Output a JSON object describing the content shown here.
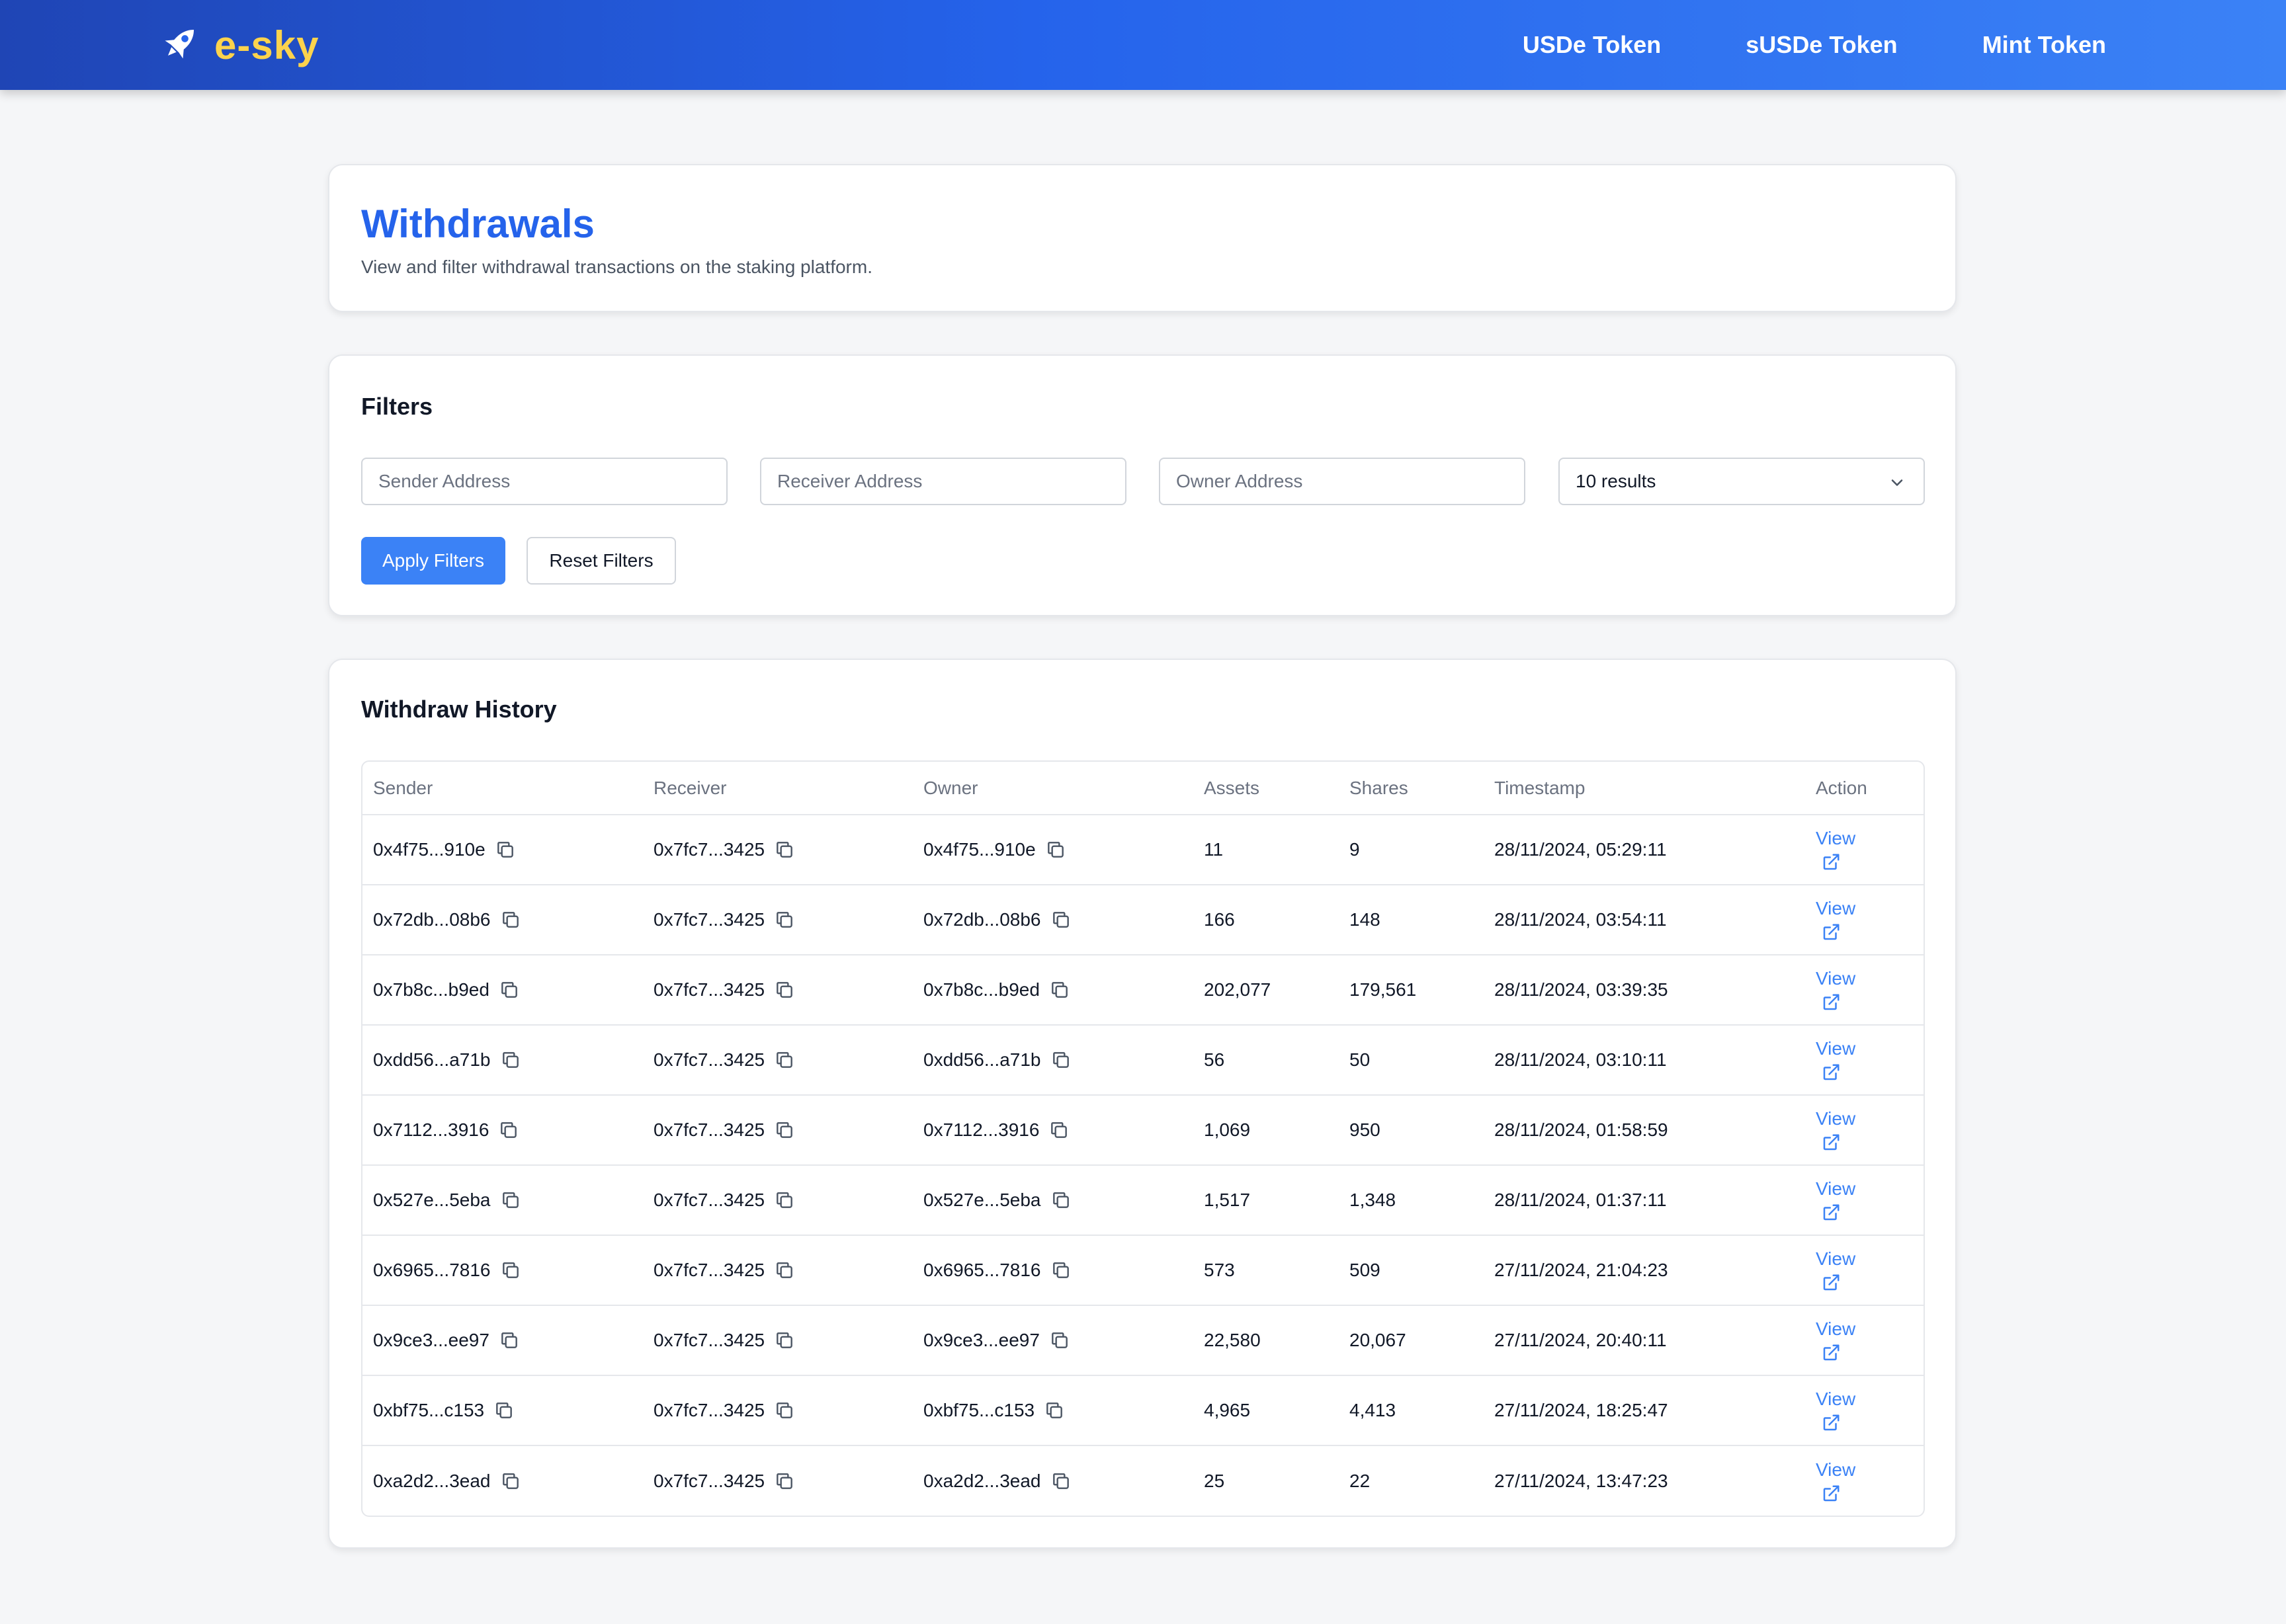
{
  "brand": {
    "name": "e-sky",
    "icon": "rocket-icon",
    "color": "#fcd34d"
  },
  "nav": {
    "links": [
      "USDe Token",
      "sUSDe Token",
      "Mint Token"
    ]
  },
  "header": {
    "title": "Withdrawals",
    "subtitle": "View and filter withdrawal transactions on the staking platform."
  },
  "filters": {
    "title": "Filters",
    "sender_placeholder": "Sender Address",
    "receiver_placeholder": "Receiver Address",
    "owner_placeholder": "Owner Address",
    "results_selected": "10 results",
    "apply_label": "Apply Filters",
    "reset_label": "Reset Filters"
  },
  "history": {
    "title": "Withdraw History",
    "columns": [
      "Sender",
      "Receiver",
      "Owner",
      "Assets",
      "Shares",
      "Timestamp",
      "Action"
    ],
    "view_label": "View",
    "rows": [
      {
        "sender": "0x4f75...910e",
        "receiver": "0x7fc7...3425",
        "owner": "0x4f75...910e",
        "assets": "11",
        "shares": "9",
        "timestamp": "28/11/2024, 05:29:11"
      },
      {
        "sender": "0x72db...08b6",
        "receiver": "0x7fc7...3425",
        "owner": "0x72db...08b6",
        "assets": "166",
        "shares": "148",
        "timestamp": "28/11/2024, 03:54:11"
      },
      {
        "sender": "0x7b8c...b9ed",
        "receiver": "0x7fc7...3425",
        "owner": "0x7b8c...b9ed",
        "assets": "202,077",
        "shares": "179,561",
        "timestamp": "28/11/2024, 03:39:35"
      },
      {
        "sender": "0xdd56...a71b",
        "receiver": "0x7fc7...3425",
        "owner": "0xdd56...a71b",
        "assets": "56",
        "shares": "50",
        "timestamp": "28/11/2024, 03:10:11"
      },
      {
        "sender": "0x7112...3916",
        "receiver": "0x7fc7...3425",
        "owner": "0x7112...3916",
        "assets": "1,069",
        "shares": "950",
        "timestamp": "28/11/2024, 01:58:59"
      },
      {
        "sender": "0x527e...5eba",
        "receiver": "0x7fc7...3425",
        "owner": "0x527e...5eba",
        "assets": "1,517",
        "shares": "1,348",
        "timestamp": "28/11/2024, 01:37:11"
      },
      {
        "sender": "0x6965...7816",
        "receiver": "0x7fc7...3425",
        "owner": "0x6965...7816",
        "assets": "573",
        "shares": "509",
        "timestamp": "27/11/2024, 21:04:23"
      },
      {
        "sender": "0x9ce3...ee97",
        "receiver": "0x7fc7...3425",
        "owner": "0x9ce3...ee97",
        "assets": "22,580",
        "shares": "20,067",
        "timestamp": "27/11/2024, 20:40:11"
      },
      {
        "sender": "0xbf75...c153",
        "receiver": "0x7fc7...3425",
        "owner": "0xbf75...c153",
        "assets": "4,965",
        "shares": "4,413",
        "timestamp": "27/11/2024, 18:25:47"
      },
      {
        "sender": "0xa2d2...3ead",
        "receiver": "0x7fc7...3425",
        "owner": "0xa2d2...3ead",
        "assets": "25",
        "shares": "22",
        "timestamp": "27/11/2024, 13:47:23"
      }
    ]
  }
}
